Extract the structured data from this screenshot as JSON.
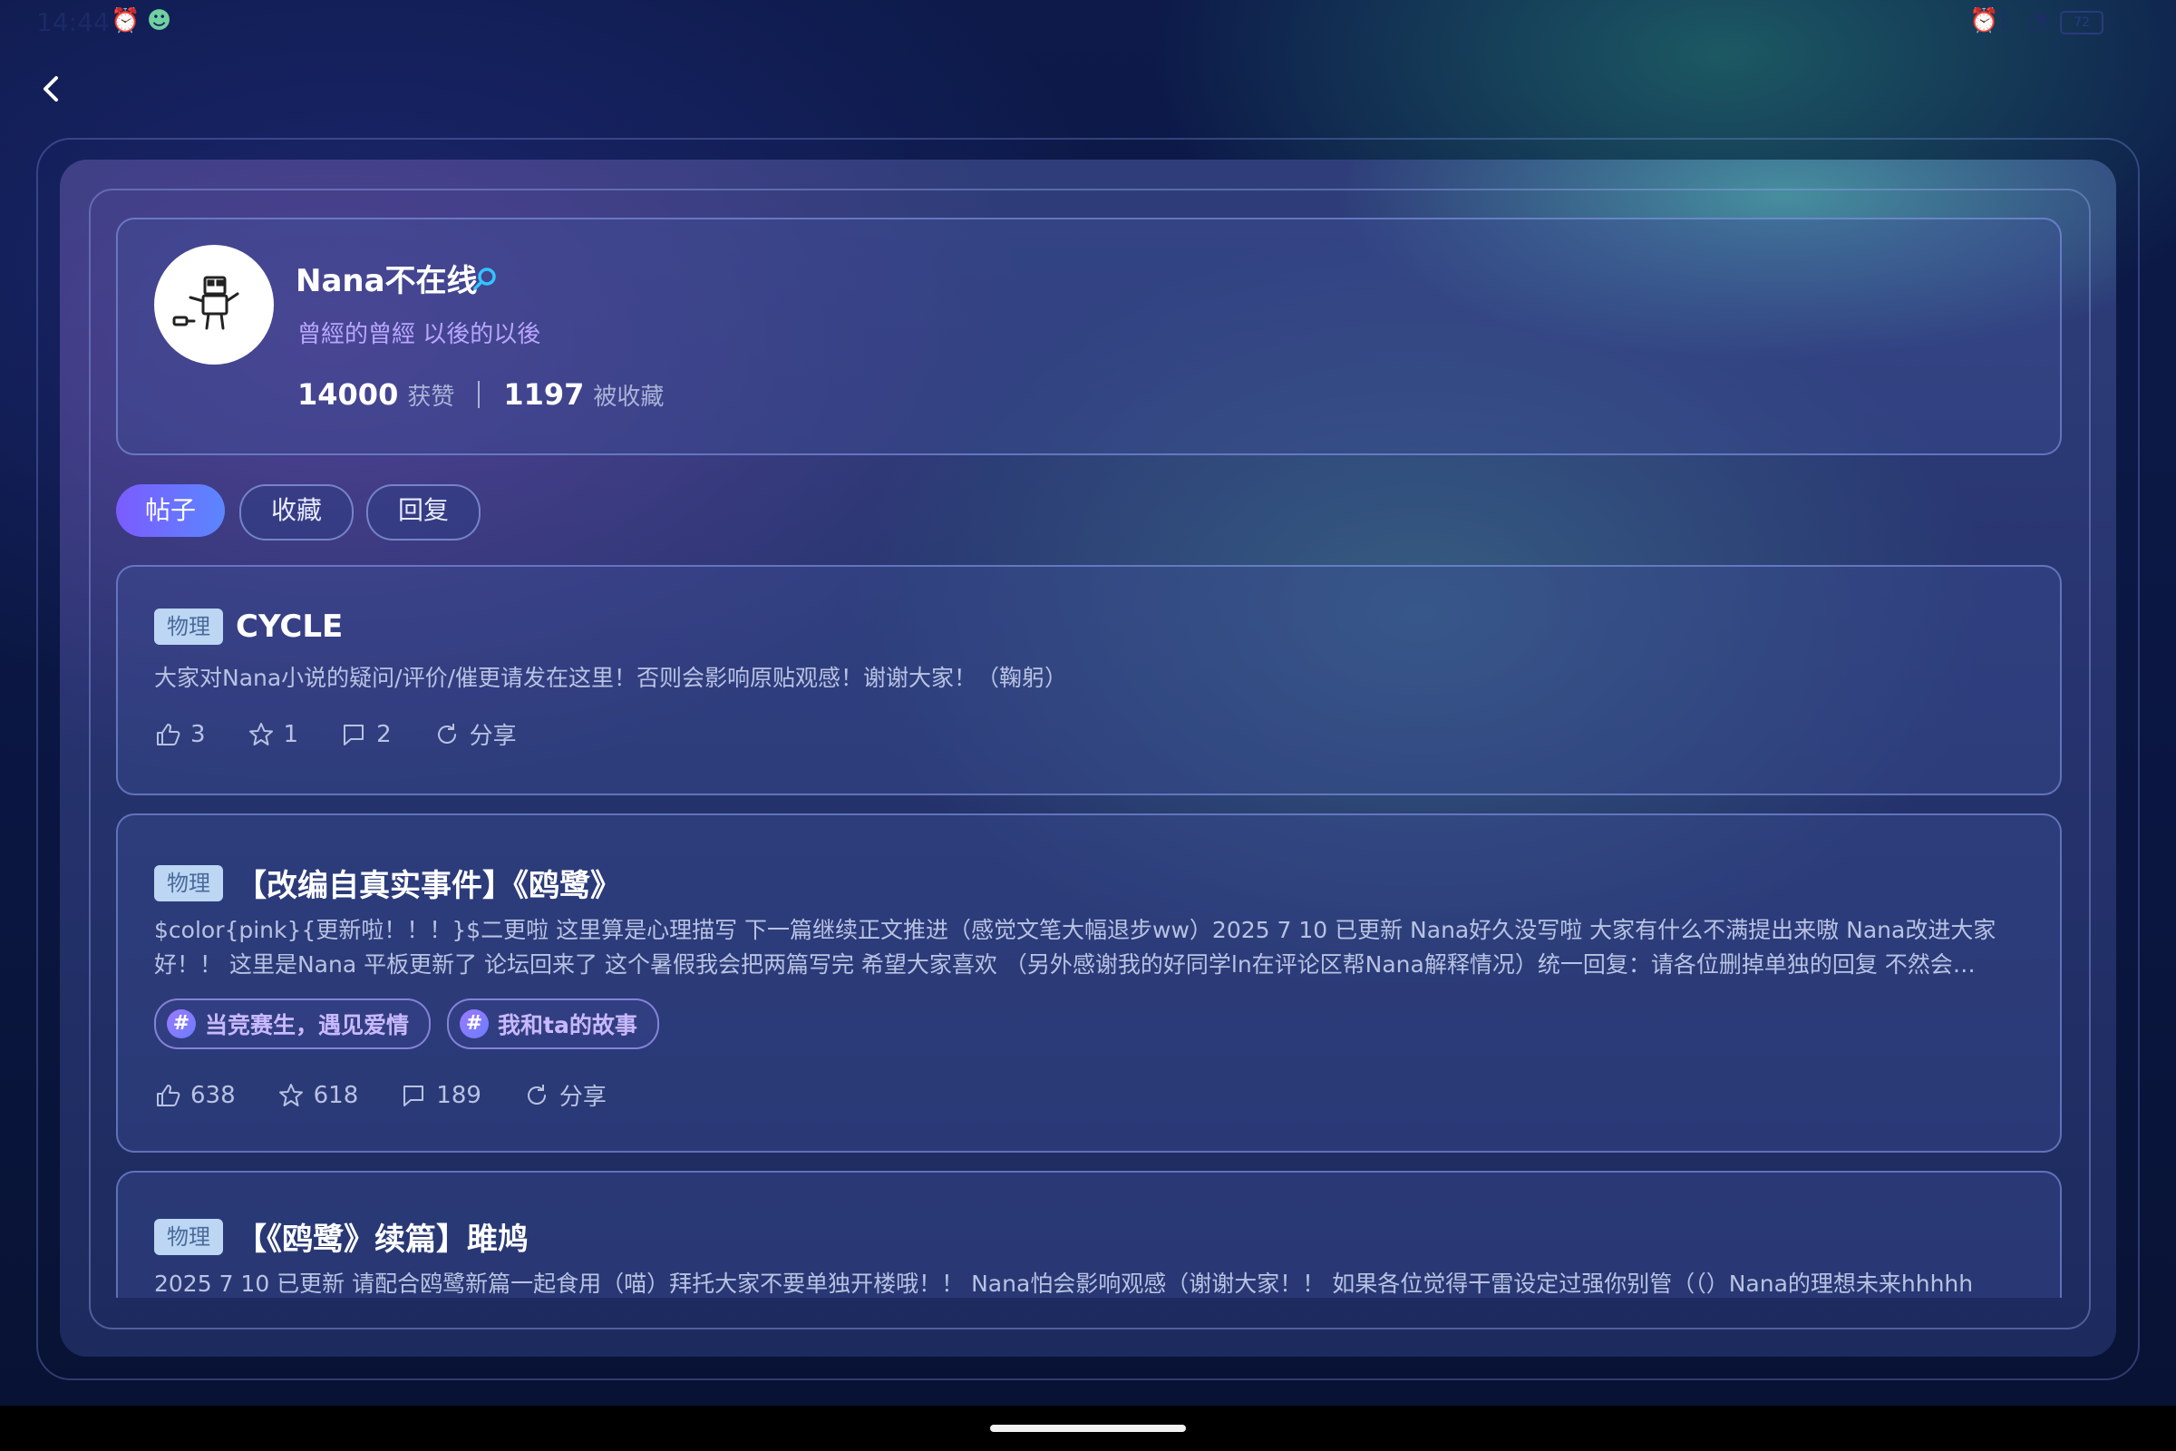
{
  "status_bar": {
    "time": "14:44",
    "battery": "72"
  },
  "colors": {
    "accent": "#7b5cff",
    "bio": "#b9a6ff",
    "tag_bg": "#bcd6f4",
    "topic": "#c8b8ff"
  },
  "profile": {
    "name": "Nana不在线",
    "bio": "曾經的曾經 以後的以後",
    "likes": "14000",
    "likes_label": "获赞",
    "favorites": "1197",
    "favorites_label": "被收藏"
  },
  "tabs": [
    {
      "label": "帖子",
      "active": true
    },
    {
      "label": "收藏",
      "active": false
    },
    {
      "label": "回复",
      "active": false
    }
  ],
  "posts": [
    {
      "tag": "物理",
      "title": "CYCLE",
      "body": "大家对Nana小说的疑问/评价/催更请发在这里！否则会影响原贴观感！谢谢大家！（鞠躬）",
      "likes": "3",
      "stars": "1",
      "comments": "2",
      "share": "分享"
    },
    {
      "tag": "物理",
      "title": "【改编自真实事件】《鸥鹭》",
      "body": "$color{pink}{更新啦！！！}$二更啦 这里算是心理描写 下一篇继续正文推进（感觉文笔大幅退步ww）2025 7 10 已更新 Nana好久没写啦 大家有什么不满提出来嗷 Nana改进大家好！！ 这里是Nana 平板更新了 论坛回来了 这个暑假我会把两篇写完 希望大家喜欢 （另外感谢我的好同学ln在评论区帮Nana解释情况）统一回复：请各位删掉单独的回复 不然会…",
      "topics": [
        "当竞赛生，遇见爱情",
        "我和ta的故事"
      ],
      "likes": "638",
      "stars": "618",
      "comments": "189",
      "share": "分享"
    },
    {
      "tag": "物理",
      "title": "【《鸥鹭》续篇】雎鸠",
      "body": "2025 7 10 已更新 请配合鸥鹭新篇一起食用（喵）拜托大家不要单独开楼哦！！ Nana怕会影响观感（谢谢大家！！ 如果各位觉得干雷设定过强你别管（（）Nana的理想未来hhhhh"
    }
  ]
}
